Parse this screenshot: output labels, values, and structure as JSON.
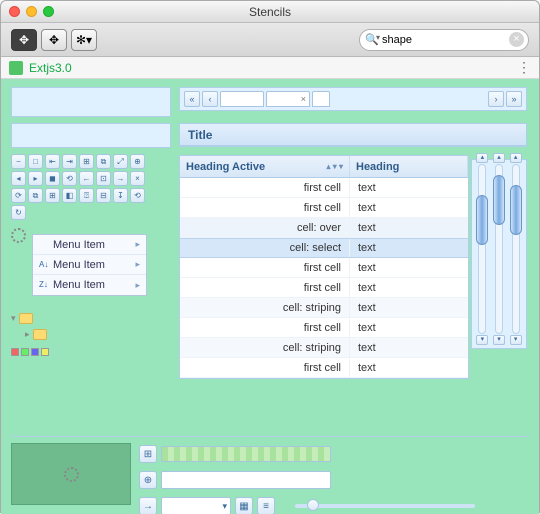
{
  "window": {
    "title": "Stencils"
  },
  "toolbar": {
    "buttons": [
      "move",
      "arrow",
      "gear"
    ],
    "search": {
      "value": "shape",
      "placeholder": ""
    }
  },
  "pathbar": {
    "doc_name": "Extjs3.0"
  },
  "left": {
    "icon_grid": [
      "−",
      "□",
      "⇤",
      "⇥",
      "⊞",
      "⧉",
      "⤢",
      "⊕",
      "◂",
      "▸",
      "◼",
      "⟲",
      "←",
      "⊡",
      "→",
      "×",
      "⟳",
      "⧉",
      "⊞",
      "◧",
      "⍰",
      "⊟",
      "↧",
      "⟲",
      "↻"
    ],
    "menu": {
      "items": [
        {
          "icon": "",
          "label": "Menu Item"
        },
        {
          "icon": "az",
          "label": "Menu Item"
        },
        {
          "icon": "za",
          "label": "Menu Item"
        }
      ]
    }
  },
  "main": {
    "title_panel": "Title",
    "grid": {
      "columns": [
        {
          "label": "Heading Active",
          "sortable": true
        },
        {
          "label": "Heading",
          "sortable": false
        }
      ],
      "rows": [
        {
          "a": "first cell",
          "b": "text",
          "state": ""
        },
        {
          "a": "first cell",
          "b": "text",
          "state": ""
        },
        {
          "a": "cell: over",
          "b": "text",
          "state": "over"
        },
        {
          "a": "cell: select",
          "b": "text",
          "state": "sel"
        },
        {
          "a": "first cell",
          "b": "text",
          "state": ""
        },
        {
          "a": "first cell",
          "b": "text",
          "state": ""
        },
        {
          "a": "cell: striping",
          "b": "text",
          "state": "stripe"
        },
        {
          "a": "first cell",
          "b": "text",
          "state": ""
        },
        {
          "a": "cell: striping",
          "b": "text",
          "state": "stripe"
        },
        {
          "a": "first cell",
          "b": "text",
          "state": ""
        }
      ]
    }
  }
}
